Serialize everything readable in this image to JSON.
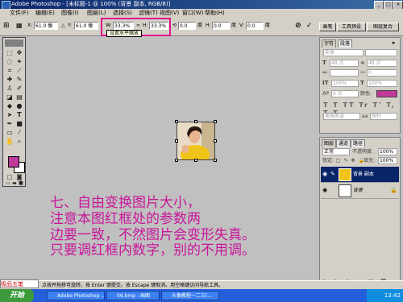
{
  "window": {
    "title": "Adobe Photoshop - [未标题-1 @ 100% (背景 副本, RGB/8)]",
    "min": "_",
    "max": "□",
    "close": "×"
  },
  "menu": [
    "文件(F)",
    "编辑(E)",
    "图像(I)",
    "图层(L)",
    "选择(S)",
    "滤镜(T)",
    "视图(V)",
    "窗口(W)",
    "帮助(H)"
  ],
  "options": {
    "x_label": "X:",
    "x_value": "61.0 像",
    "y_label": "Y:",
    "y_value": "61.0 像",
    "w_label": "W:",
    "w_value": "33.3%",
    "h_label": "H:",
    "h_value": "33.3%",
    "angle_value": "0.0",
    "angle_unit": "度",
    "hskew_label": "H:",
    "hskew_value": "0.0",
    "vskew_label": "V:",
    "vskew_value": "0.0",
    "tooltip": "设置水平缩放",
    "tab_brushes": "画笔",
    "tab_presets": "工具预设",
    "tab_comps": "图层复合"
  },
  "char_panel": {
    "tab_char": "字符",
    "tab_para": "段落",
    "font": "宋体",
    "size": "48 点",
    "leading": "48 点",
    "tracking": "0",
    "vscale": "100%",
    "hscale": "100%",
    "baseline": "0 点",
    "color_label": "颜色:",
    "lang": "美国英语",
    "aa": "aa",
    "aa_mode": "锐利"
  },
  "layers_panel": {
    "tabs": [
      "图层",
      "通道",
      "路径"
    ],
    "blend_mode": "正常",
    "opacity_label": "不透明度:",
    "opacity": "100%",
    "lock_label": "锁定:",
    "fill_label": "填充:",
    "fill": "100%",
    "layers": [
      {
        "name": "背景 副本",
        "selected": true
      },
      {
        "name": "背景",
        "selected": false
      }
    ]
  },
  "instruction": {
    "line1": "七、自由变换图片大小，",
    "line2": "注意本图红框处的参数两",
    "line3": "边要一致，不然图片会变形失真。",
    "line4": "只要调红框内数字，别的不用调。"
  },
  "statusbar": {
    "text": "点按并拖移可旋转。按 Enter 键提交。按 Escape 键取消。用空格键访问导航工具。"
  },
  "ime": "极品五笔",
  "taskbar": {
    "start": "开始",
    "tasks": [
      "Adobe Photoshop ...",
      "06.bmp - 画图",
      "头像教程一二三(..."
    ],
    "clock": "13:42"
  },
  "colors": {
    "accent_pink": "#c8169a",
    "red_box": "#e0158a",
    "title_blue": "#0a246a",
    "taskbar_blue": "#245edb"
  }
}
